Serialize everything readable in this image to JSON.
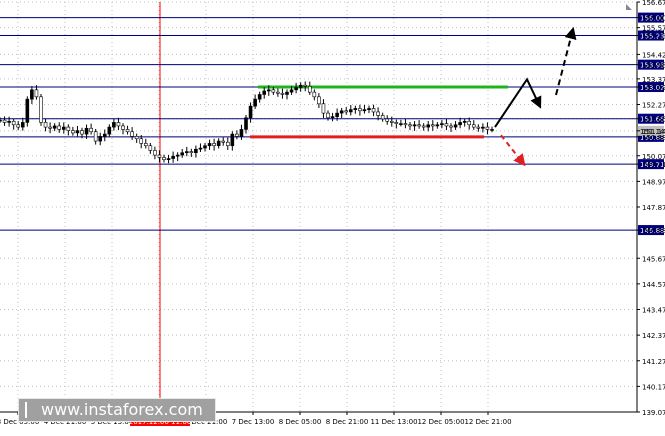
{
  "chart_data": {
    "type": "candlestick",
    "ylim": [
      139.07,
      156.67
    ],
    "grid": true,
    "y_ticks": [
      "156.67",
      "156.00",
      "155.57",
      "155.23",
      "154.42",
      "153.98",
      "153.37",
      "153.02",
      "152.27",
      "151.66",
      "151.14",
      "150.88",
      "150.07",
      "149.71",
      "148.97",
      "147.87",
      "146.88",
      "145.67",
      "144.57",
      "143.47",
      "142.37",
      "141.27",
      "140.17",
      "139.07"
    ],
    "x_ticks": [
      "3 Dec 05:00",
      "4 Dec 21:00",
      "5 Dec 13:00",
      "6 Dec 05:00",
      "6 Dec 21:00",
      "7 Dec 13:00",
      "8 Dec 05:00",
      "8 Dec 21:00",
      "11 Dec 13:00",
      "12 Dec 05:00",
      "12 Dec 21:00"
    ],
    "highlighted_x_label": "2017.12.06 11:00",
    "levels": [
      {
        "value": 156.0,
        "label": "156.00"
      },
      {
        "value": 155.23,
        "label": "155.23"
      },
      {
        "value": 153.98,
        "label": "153.98"
      },
      {
        "value": 153.02,
        "label": "153.02"
      },
      {
        "value": 151.66,
        "label": "151.66"
      },
      {
        "value": 150.88,
        "label": "150.88"
      },
      {
        "value": 149.71,
        "label": "149.71"
      },
      {
        "value": 146.88,
        "label": "146.88"
      }
    ],
    "current_price": {
      "value": 151.14,
      "label": "151.14"
    },
    "resistance_zone": {
      "value": 153.02,
      "color": "#1db41d"
    },
    "support_zone": {
      "value": 150.88,
      "color": "#e02020"
    },
    "scenarios": [
      {
        "style": "solid",
        "color": "#000000",
        "path": [
          151.3,
          153.35,
          152.18
        ]
      },
      {
        "style": "dashed",
        "color": "#000000",
        "path": [
          152.68,
          155.5
        ]
      },
      {
        "style": "dashed",
        "color": "#e02020",
        "path": [
          150.95,
          149.7
        ]
      }
    ],
    "series": [
      {
        "values": [
          151.6,
          151.5,
          151.55,
          151.4,
          151.3,
          151.5,
          152.5,
          152.9,
          152.6,
          151.5,
          151.3,
          151.25,
          151.35,
          151.2,
          151.3,
          151.15,
          151.05,
          151.15,
          151.0,
          151.25,
          151.1,
          150.7,
          150.9,
          151.0,
          151.3,
          151.5,
          151.35,
          151.2,
          151.1,
          150.9,
          150.8,
          150.6,
          150.5,
          150.3,
          150.1,
          150.0,
          149.9,
          149.95,
          150.05,
          150.1,
          150.2,
          150.25,
          150.2,
          150.35,
          150.4,
          150.5,
          150.6,
          150.5,
          150.7,
          150.65,
          150.5,
          151.0,
          150.9,
          151.2,
          151.7,
          152.2,
          152.5,
          152.7,
          152.85,
          152.9,
          152.8,
          152.75,
          152.7,
          152.8,
          152.9,
          153.0,
          153.1,
          153.05,
          152.8,
          152.6,
          152.3,
          151.9,
          151.7,
          151.75,
          151.9,
          152.0,
          151.95,
          152.05,
          152.1,
          152.0,
          152.05,
          152.1,
          151.95,
          151.8,
          151.65,
          151.55,
          151.5,
          151.45,
          151.45,
          151.4,
          151.35,
          151.4,
          151.35,
          151.3,
          151.4,
          151.35,
          151.4,
          151.45,
          151.35,
          151.3,
          151.4,
          151.5,
          151.55,
          151.4,
          151.3,
          151.25,
          151.3,
          151.2,
          151.2
        ]
      }
    ]
  },
  "footer": {
    "watermark": "www.instaforex.com"
  },
  "colors": {
    "level_line": "#00007f",
    "grid": "#c0c0c0",
    "current_price_bg": "#c0c0c0",
    "watermark_bg": "#a0a0a0",
    "highlight": "#ff0000"
  }
}
